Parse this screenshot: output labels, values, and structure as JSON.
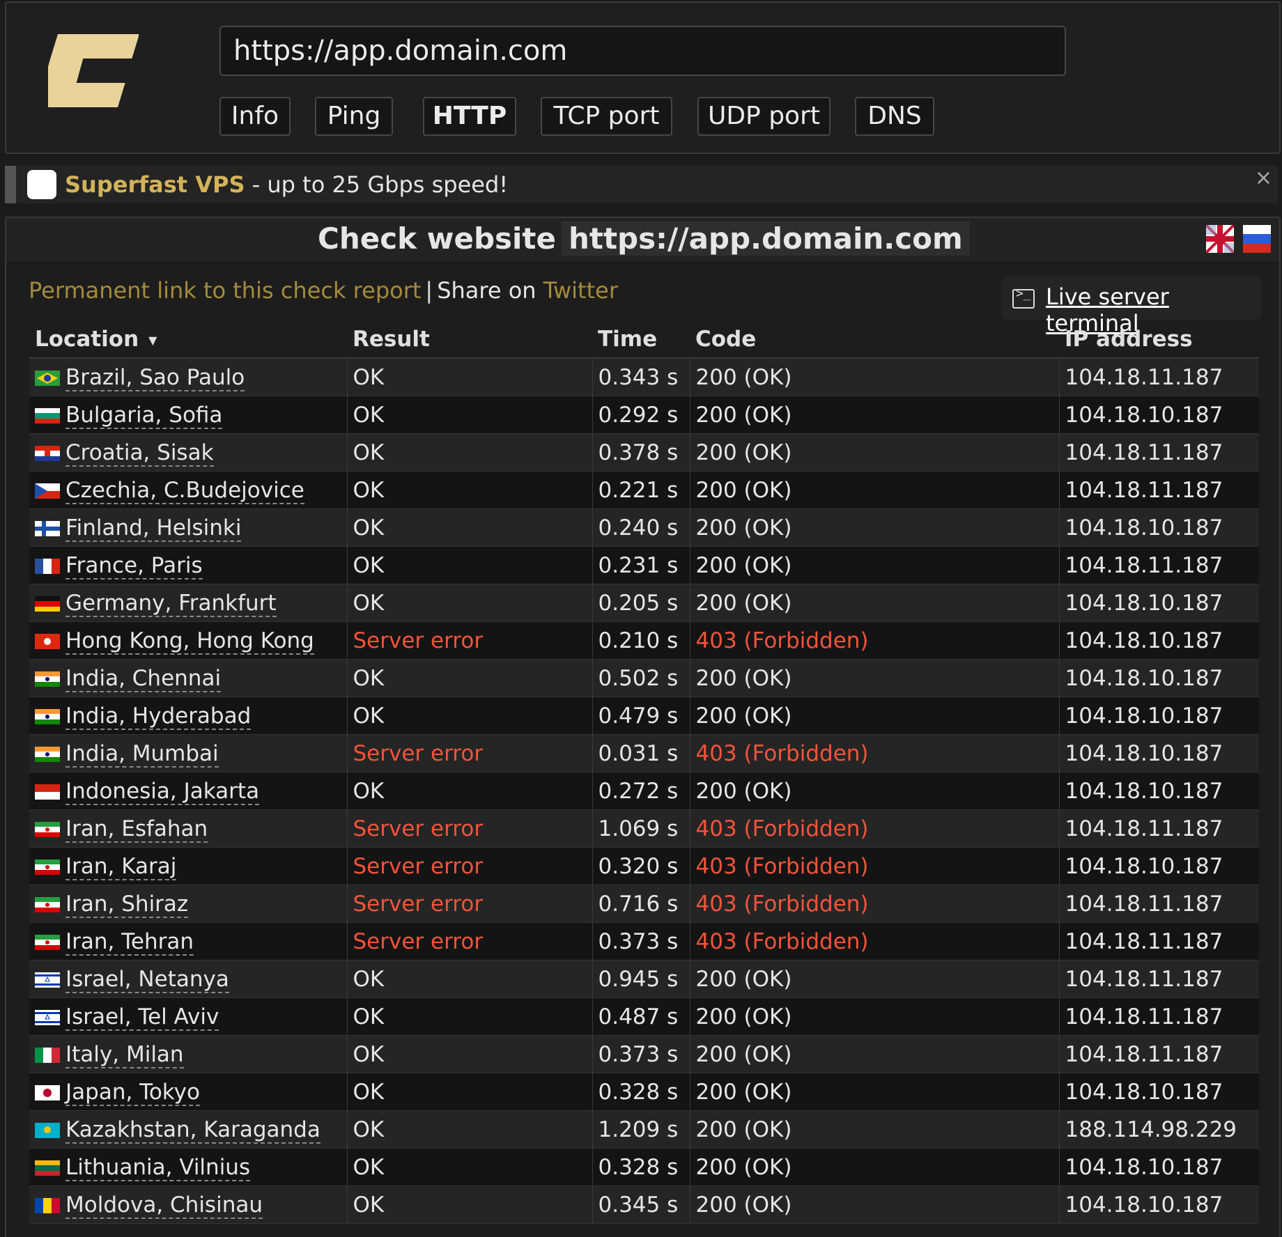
{
  "header": {
    "url_value": "https://app.domain.com",
    "logo": "c-logo-icon",
    "tabs": [
      {
        "label": "Info",
        "active": false
      },
      {
        "label": "Ping",
        "active": false
      },
      {
        "label": "HTTP",
        "active": true
      },
      {
        "label": "TCP port",
        "active": false
      },
      {
        "label": "UDP port",
        "active": false
      },
      {
        "label": "DNS",
        "active": false
      }
    ]
  },
  "promo": {
    "brand": "Superfast VPS",
    "text": " - up to 25 Gbps speed!",
    "close_icon": "close-icon"
  },
  "report": {
    "title_prefix": "Check website",
    "title_url": "https://app.domain.com",
    "permalink": "Permanent link to this check report",
    "separator": "|",
    "share_prefix": "Share on ",
    "share_target": "Twitter",
    "terminal_label": "Live server terminal",
    "columns": [
      "Location",
      "Result",
      "Time",
      "Code",
      "IP address"
    ],
    "rows": [
      {
        "flag": "brazil",
        "location": "Brazil, Sao Paulo",
        "result": "OK",
        "time": "0.343 s",
        "code": "200 (OK)",
        "ip": "104.18.11.187",
        "error": false
      },
      {
        "flag": "bulgaria",
        "location": "Bulgaria, Sofia",
        "result": "OK",
        "time": "0.292 s",
        "code": "200 (OK)",
        "ip": "104.18.10.187",
        "error": false
      },
      {
        "flag": "croatia",
        "location": "Croatia, Sisak",
        "result": "OK",
        "time": "0.378 s",
        "code": "200 (OK)",
        "ip": "104.18.11.187",
        "error": false
      },
      {
        "flag": "czechia",
        "location": "Czechia, C.Budejovice",
        "result": "OK",
        "time": "0.221 s",
        "code": "200 (OK)",
        "ip": "104.18.11.187",
        "error": false
      },
      {
        "flag": "finland",
        "location": "Finland, Helsinki",
        "result": "OK",
        "time": "0.240 s",
        "code": "200 (OK)",
        "ip": "104.18.10.187",
        "error": false
      },
      {
        "flag": "france",
        "location": "France, Paris",
        "result": "OK",
        "time": "0.231 s",
        "code": "200 (OK)",
        "ip": "104.18.11.187",
        "error": false
      },
      {
        "flag": "germany",
        "location": "Germany, Frankfurt",
        "result": "OK",
        "time": "0.205 s",
        "code": "200 (OK)",
        "ip": "104.18.10.187",
        "error": false
      },
      {
        "flag": "hongkong",
        "location": "Hong Kong, Hong Kong",
        "result": "Server error",
        "time": "0.210 s",
        "code": "403 (Forbidden)",
        "ip": "104.18.10.187",
        "error": true
      },
      {
        "flag": "india",
        "location": "India, Chennai",
        "result": "OK",
        "time": "0.502 s",
        "code": "200 (OK)",
        "ip": "104.18.10.187",
        "error": false
      },
      {
        "flag": "india",
        "location": "India, Hyderabad",
        "result": "OK",
        "time": "0.479 s",
        "code": "200 (OK)",
        "ip": "104.18.10.187",
        "error": false
      },
      {
        "flag": "india",
        "location": "India, Mumbai",
        "result": "Server error",
        "time": "0.031 s",
        "code": "403 (Forbidden)",
        "ip": "104.18.10.187",
        "error": true
      },
      {
        "flag": "indonesia",
        "location": "Indonesia, Jakarta",
        "result": "OK",
        "time": "0.272 s",
        "code": "200 (OK)",
        "ip": "104.18.10.187",
        "error": false
      },
      {
        "flag": "iran",
        "location": "Iran, Esfahan",
        "result": "Server error",
        "time": "1.069 s",
        "code": "403 (Forbidden)",
        "ip": "104.18.11.187",
        "error": true
      },
      {
        "flag": "iran",
        "location": "Iran, Karaj",
        "result": "Server error",
        "time": "0.320 s",
        "code": "403 (Forbidden)",
        "ip": "104.18.10.187",
        "error": true
      },
      {
        "flag": "iran",
        "location": "Iran, Shiraz",
        "result": "Server error",
        "time": "0.716 s",
        "code": "403 (Forbidden)",
        "ip": "104.18.11.187",
        "error": true
      },
      {
        "flag": "iran",
        "location": "Iran, Tehran",
        "result": "Server error",
        "time": "0.373 s",
        "code": "403 (Forbidden)",
        "ip": "104.18.11.187",
        "error": true
      },
      {
        "flag": "israel",
        "location": "Israel, Netanya",
        "result": "OK",
        "time": "0.945 s",
        "code": "200 (OK)",
        "ip": "104.18.11.187",
        "error": false
      },
      {
        "flag": "israel",
        "location": "Israel, Tel Aviv",
        "result": "OK",
        "time": "0.487 s",
        "code": "200 (OK)",
        "ip": "104.18.11.187",
        "error": false
      },
      {
        "flag": "italy",
        "location": "Italy, Milan",
        "result": "OK",
        "time": "0.373 s",
        "code": "200 (OK)",
        "ip": "104.18.11.187",
        "error": false
      },
      {
        "flag": "japan",
        "location": "Japan, Tokyo",
        "result": "OK",
        "time": "0.328 s",
        "code": "200 (OK)",
        "ip": "104.18.10.187",
        "error": false
      },
      {
        "flag": "kazakhstan",
        "location": "Kazakhstan, Karaganda",
        "result": "OK",
        "time": "1.209 s",
        "code": "200 (OK)",
        "ip": "188.114.98.229",
        "error": false
      },
      {
        "flag": "lithuania",
        "location": "Lithuania, Vilnius",
        "result": "OK",
        "time": "0.328 s",
        "code": "200 (OK)",
        "ip": "104.18.10.187",
        "error": false
      },
      {
        "flag": "moldova",
        "location": "Moldova, Chisinau",
        "result": "OK",
        "time": "0.345 s",
        "code": "200 (OK)",
        "ip": "104.18.10.187",
        "error": false
      }
    ]
  },
  "colors": {
    "accent_gold": "#d3b25a",
    "link_gold": "#a48b3c",
    "error_red": "#f2543a",
    "background": "#1b1b1b"
  }
}
